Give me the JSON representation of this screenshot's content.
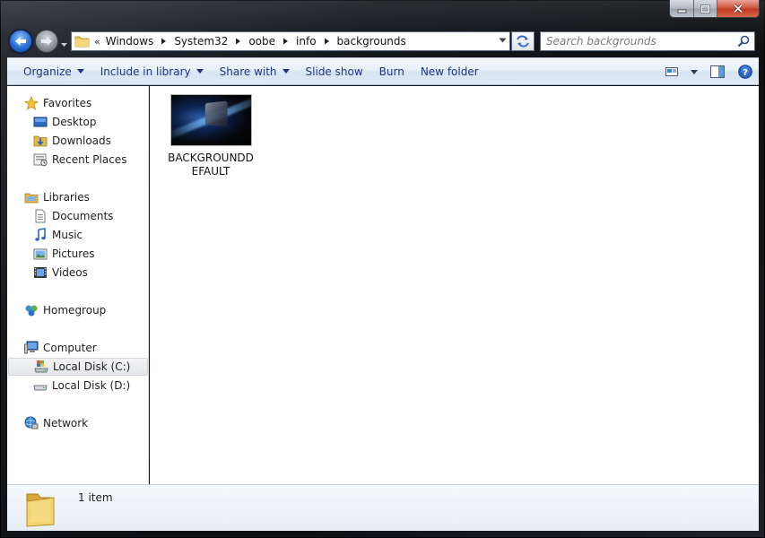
{
  "window": {
    "caption_buttons": [
      "minimize",
      "maximize",
      "close"
    ]
  },
  "address_bar": {
    "overflow": "«",
    "breadcrumbs": [
      "Windows",
      "System32",
      "oobe",
      "info",
      "backgrounds"
    ]
  },
  "search": {
    "placeholder": "Search backgrounds"
  },
  "toolbar": {
    "organize": "Organize",
    "include_in_library": "Include in library",
    "share_with": "Share with",
    "slide_show": "Slide show",
    "burn": "Burn",
    "new_folder": "New folder"
  },
  "nav_pane": {
    "favorites": {
      "label": "Favorites",
      "items": [
        "Desktop",
        "Downloads",
        "Recent Places"
      ]
    },
    "libraries": {
      "label": "Libraries",
      "items": [
        "Documents",
        "Music",
        "Pictures",
        "Videos"
      ]
    },
    "homegroup": {
      "label": "Homegroup"
    },
    "computer": {
      "label": "Computer",
      "items": [
        "Local Disk (C:)",
        "Local Disk (D:)"
      ],
      "selected": "Local Disk (C:)"
    },
    "network": {
      "label": "Network"
    }
  },
  "content": {
    "files": [
      {
        "name": "BACKGROUNDDEFAULT"
      }
    ]
  },
  "details": {
    "item_count": "1 item"
  },
  "colors": {
    "command_text": "#1e3287",
    "selection": "#e4e6e9",
    "close_button": "#c03a22"
  }
}
